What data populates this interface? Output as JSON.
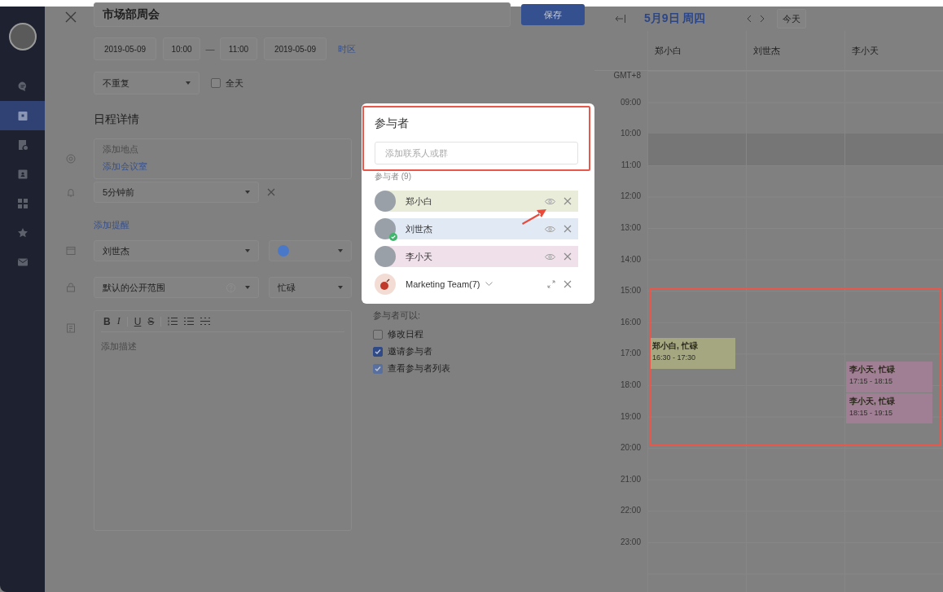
{
  "sidebar": {
    "items": [
      {
        "kind": "chat",
        "selected": false
      },
      {
        "kind": "calendar",
        "selected": true
      },
      {
        "kind": "document",
        "selected": false
      },
      {
        "kind": "contacts",
        "selected": false
      },
      {
        "kind": "apps",
        "selected": false
      },
      {
        "kind": "star",
        "selected": false
      },
      {
        "kind": "mail",
        "selected": false
      }
    ]
  },
  "event_form": {
    "title": "市场部周会",
    "save_button": "保存",
    "start_date": "2019-05-09",
    "start_time": "10:00",
    "separator": "—",
    "end_time": "11:00",
    "end_date": "2019-05-09",
    "timezone_link": "时区",
    "repeat": "不重复",
    "all_day": {
      "label": "全天",
      "checked": false
    },
    "details_heading": "日程详情",
    "location": {
      "placeholder": "添加地点",
      "room_link": "添加会议室"
    },
    "reminder": {
      "value": "5分钟前",
      "add_link": "添加提醒"
    },
    "calendar": {
      "value": "刘世杰",
      "color": "#4a78c8"
    },
    "visibility": {
      "value": "默认的公开范围",
      "status": "忙碌"
    },
    "description": {
      "toolbar": [
        {
          "kind": "bold",
          "label": "B"
        },
        {
          "kind": "italic",
          "label": "I"
        },
        {
          "kind": "divider"
        },
        {
          "kind": "underline",
          "label": "U"
        },
        {
          "kind": "strike",
          "label": "S"
        },
        {
          "kind": "divider"
        },
        {
          "kind": "ordered-list"
        },
        {
          "kind": "bullet-list"
        },
        {
          "kind": "rule"
        }
      ],
      "placeholder": "添加描述"
    }
  },
  "attendee_permissions": {
    "label": "参与者可以:",
    "options": [
      {
        "label": "修改日程",
        "checked": false,
        "disabled": false
      },
      {
        "label": "邀请参与者",
        "checked": true,
        "disabled": false
      },
      {
        "label": "查看参与者列表",
        "checked": true,
        "disabled": true
      }
    ]
  },
  "attendees_popup": {
    "title": "参与者",
    "search": {
      "placeholder": "添加联系人或群"
    },
    "count_label": "参与者 (9)",
    "attendees": [
      {
        "kind": "person",
        "name": "郑小白",
        "color": "#e8ecd9",
        "accepted": false
      },
      {
        "kind": "person",
        "name": "刘世杰",
        "color": "#e1e9f5",
        "accepted": true
      },
      {
        "kind": "person",
        "name": "李小天",
        "color": "#f0e0ea",
        "accepted": false
      },
      {
        "kind": "group",
        "name": "Marketing Team(7)"
      }
    ]
  },
  "calendar_view": {
    "date_title": "5月9日 周四",
    "today_button": "今天",
    "hours": [
      "GMT+8",
      "09:00",
      "10:00",
      "11:00",
      "12:00",
      "13:00",
      "14:00",
      "15:00",
      "16:00",
      "17:00",
      "18:00",
      "19:00",
      "20:00",
      "21:00",
      "22:00",
      "23:00"
    ],
    "columns": [
      {
        "name": "郑小白",
        "events": [
          {
            "title": "郑小白, 忙碌",
            "time": "16:30 - 17:30",
            "color": "#a4a77f"
          }
        ]
      },
      {
        "name": "刘世杰"
      },
      {
        "name": "李小天",
        "events": [
          {
            "title": "李小天, 忙碌",
            "time": "17:15 - 18:15",
            "color": "#a07f94"
          },
          {
            "title": "李小天, 忙碌",
            "time": "18:15 - 19:15",
            "color": "#a07f94"
          }
        ]
      }
    ]
  }
}
